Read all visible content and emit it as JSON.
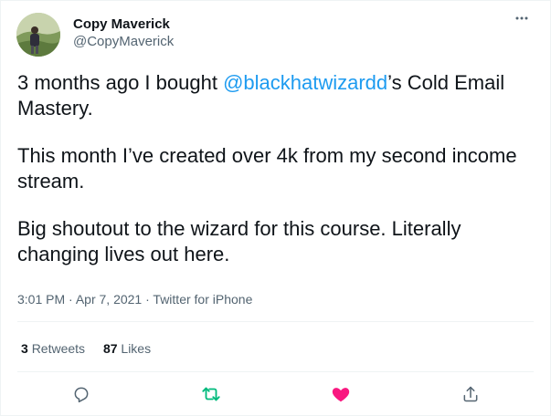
{
  "user": {
    "display_name": "Copy Maverick",
    "handle": "@CopyMaverick",
    "avatar_icon": "profile-photo"
  },
  "tweet": {
    "paragraph1_before": "3 months ago I bought ",
    "mention": "@blackhatwizardd",
    "paragraph1_after": "’s Cold Email Mastery.",
    "paragraph2": "This month I’ve created over 4k from my second income stream.",
    "paragraph3": "Big shoutout to the wizard for this course. Literally changing lives out here."
  },
  "meta": {
    "time": "3:01 PM",
    "separator": "·",
    "date": "Apr 7, 2021",
    "source": "Twitter for iPhone"
  },
  "stats": {
    "retweets_count": "3",
    "retweets_label": "Retweets",
    "likes_count": "87",
    "likes_label": "Likes"
  },
  "actions": {
    "reply_icon": "reply-icon",
    "retweet_icon": "retweet-icon",
    "like_icon": "heart-icon",
    "share_icon": "share-icon"
  },
  "colors": {
    "link": "#1d9bf0",
    "retweet": "#00ba7c",
    "like": "#f91880",
    "secondary_text": "#536471",
    "primary_text": "#0f1419"
  }
}
